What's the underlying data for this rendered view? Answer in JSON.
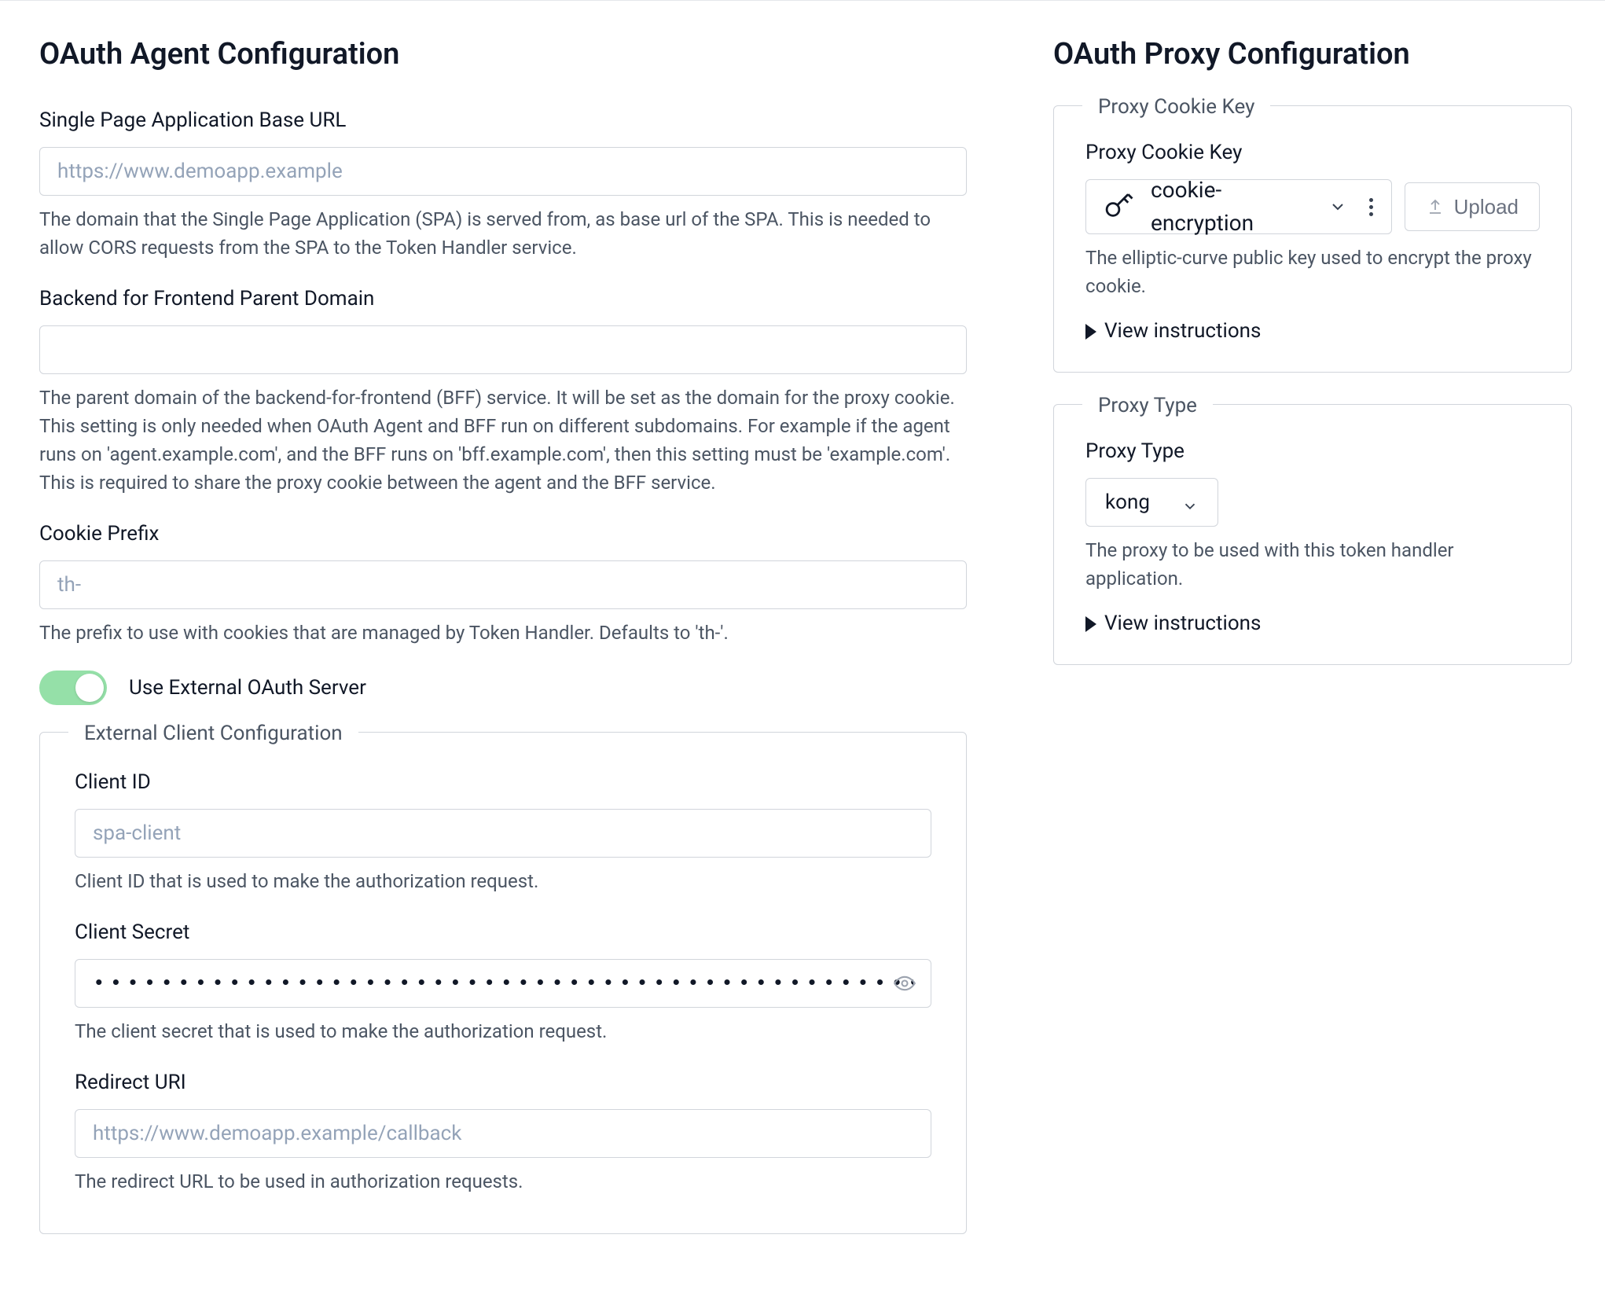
{
  "agent": {
    "title": "OAuth Agent Configuration",
    "spa_url": {
      "label": "Single Page Application Base URL",
      "placeholder": "https://www.demoapp.example",
      "value": "",
      "help": "The domain that the Single Page Application (SPA) is served from, as base url of the SPA. This is needed to allow CORS requests from the SPA to the Token Handler service."
    },
    "bff_domain": {
      "label": "Backend for Frontend Parent Domain",
      "value": "",
      "help": "The parent domain of the backend-for-frontend (BFF) service. It will be set as the domain for the proxy cookie. This setting is only needed when OAuth Agent and BFF run on different subdomains. For example if the agent runs on 'agent.example.com', and the BFF runs on 'bff.example.com', then this setting must be 'example.com'. This is required to share the proxy cookie between the agent and the BFF service."
    },
    "cookie_prefix": {
      "label": "Cookie Prefix",
      "placeholder": "th-",
      "value": "",
      "help": "The prefix to use with cookies that are managed by Token Handler. Defaults to 'th-'."
    },
    "external_toggle": {
      "label": "Use External OAuth Server",
      "on": true
    },
    "external": {
      "legend": "External Client Configuration",
      "client_id": {
        "label": "Client ID",
        "placeholder": "spa-client",
        "value": "",
        "help": "Client ID that is used to make the authorization request."
      },
      "client_secret": {
        "label": "Client Secret",
        "masked": "•••••••••••••••••••••••••••••••••••••••••••••••••••••••••••••••••••••••••••••",
        "help": "The client secret that is used to make the authorization request."
      },
      "redirect_uri": {
        "label": "Redirect URI",
        "placeholder": "https://www.demoapp.example/callback",
        "value": "",
        "help": "The redirect URL to be used in authorization requests."
      }
    }
  },
  "proxy": {
    "title": "OAuth Proxy Configuration",
    "cookie_key": {
      "legend": "Proxy Cookie Key",
      "label": "Proxy Cookie Key",
      "selected": "cookie-encryption",
      "upload_label": "Upload",
      "help": "The elliptic-curve public key used to encrypt the proxy cookie.",
      "view_instructions": "View instructions"
    },
    "proxy_type": {
      "legend": "Proxy Type",
      "label": "Proxy Type",
      "selected": "kong",
      "help": "The proxy to be used with this token handler application.",
      "view_instructions": "View instructions"
    }
  }
}
